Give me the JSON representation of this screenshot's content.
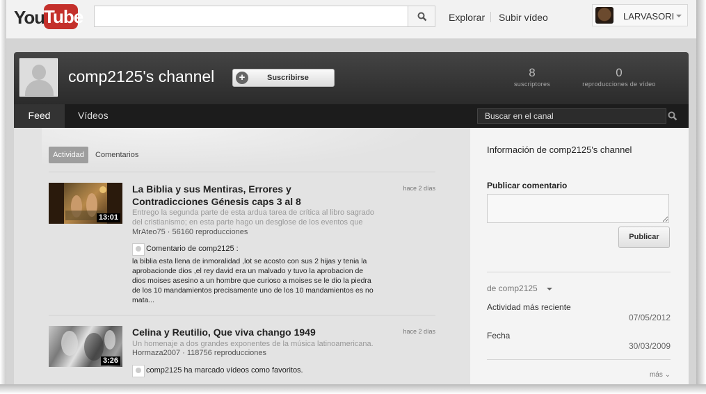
{
  "masthead": {
    "logo_you": "You",
    "logo_tube": "Tube",
    "search_placeholder": "",
    "nav_explore": "Explorar",
    "nav_upload": "Subir vídeo",
    "username": "LARVASORI"
  },
  "channel": {
    "title": "comp2125's channel",
    "subscribe_label": "Suscribirse",
    "subscribe_icon": "+",
    "stats": {
      "subscribers_count": "8",
      "subscribers_label": "suscriptores",
      "views_count": "0",
      "views_label": "reproducciones de vídeo"
    },
    "tabs": [
      {
        "label": "Feed",
        "active": true
      },
      {
        "label": "Vídeos",
        "active": false
      }
    ],
    "search_placeholder": "Buscar en el canal"
  },
  "feed": {
    "filters": {
      "activity": "Actividad",
      "comments": "Comentarios"
    },
    "items": [
      {
        "title": "La Biblia y sus Mentiras, Errores y Contradicciones Génesis caps 3 al 8",
        "time": "hace 2 días",
        "description": "Entrego la segunda parte de esta ardua tarea de crítica al libro sagrado del cristianismo; en esta parte hago un desglose de los eventos que",
        "meta": "MrAteo75 · 56160 reproducciones",
        "duration": "13:01",
        "action": "Comentario de comp2125 :",
        "comment": "la biblia esta llena de inmoralidad ,lot se acosto con sus 2 hijas y tenia la aprobacionde dios ,el rey david era un malvado y tuvo la aprobacion de dios moises asesino a un hombre que curioso a moises se le dio la piedra de los 10 mandamientos precisamente uno de los 10 mandamientos es no mata..."
      },
      {
        "title": "Celina y Reutilio, Que viva chango 1949",
        "time": "hace 2 días",
        "description": "Un homenaje a dos grandes exponentes de la música latinoamericana.",
        "meta": "Hormaza2007 · 118756 reproducciones",
        "duration": "3:26",
        "action": "comp2125 ha marcado vídeos como favoritos."
      }
    ]
  },
  "sidebar": {
    "about_title": "Información de comp2125's channel",
    "post_comment_label": "Publicar comentario",
    "post_button": "Publicar",
    "from_user": "de comp2125",
    "recent_activity_label": "Actividad más reciente",
    "recent_activity_value": "07/05/2012",
    "date_label": "Fecha",
    "date_value": "30/03/2009",
    "more_link": "más ⌄"
  },
  "colors": {
    "brand_red": "#c4302b",
    "header_dark": "#2b2b2b"
  }
}
